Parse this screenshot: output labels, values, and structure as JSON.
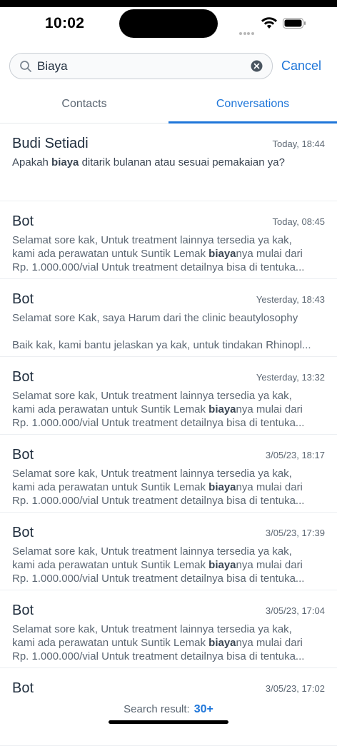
{
  "status_bar": {
    "time": "10:02"
  },
  "search": {
    "value": "Biaya",
    "cancel_label": "Cancel"
  },
  "tabs": [
    {
      "label": "Contacts",
      "active": false
    },
    {
      "label": "Conversations",
      "active": true
    }
  ],
  "conversations": [
    {
      "name": "Budi Setiadi",
      "date": "Today, 18:44",
      "lines": [
        [
          "Apakah ",
          "biaya",
          " ditarik bulanan atau sesuai pemakaian ya?"
        ]
      ]
    },
    {
      "name": "Bot",
      "date": "Today, 08:45",
      "lines": [
        [
          "Selamat sore kak, Untuk treatment lainnya tersedia ya kak,"
        ],
        [
          "kami ada perawatan untuk Suntik Lemak ",
          "biaya",
          "nya mulai dari"
        ],
        [
          "Rp. 1.000.000/vial Untuk treatment detailnya bisa di tentuka..."
        ]
      ]
    },
    {
      "name": "Bot",
      "date": "Yesterday, 18:43",
      "lines": [
        [
          "Selamat sore Kak, saya Harum dari the clinic beautylosophy"
        ],
        [],
        [
          "Baik kak, kami bantu jelaskan ya kak, untuk tindakan Rhinopl..."
        ]
      ]
    },
    {
      "name": "Bot",
      "date": "Yesterday, 13:32",
      "lines": [
        [
          "Selamat sore kak, Untuk treatment lainnya tersedia ya kak,"
        ],
        [
          "kami ada perawatan untuk Suntik Lemak ",
          "biaya",
          "nya mulai dari"
        ],
        [
          "Rp. 1.000.000/vial Untuk treatment detailnya bisa di tentuka..."
        ]
      ]
    },
    {
      "name": "Bot",
      "date": "3/05/23, 18:17",
      "lines": [
        [
          "Selamat sore kak, Untuk treatment lainnya tersedia ya kak,"
        ],
        [
          "kami ada perawatan untuk Suntik Lemak ",
          "biaya",
          "nya mulai dari"
        ],
        [
          "Rp. 1.000.000/vial Untuk treatment detailnya bisa di tentuka..."
        ]
      ]
    },
    {
      "name": "Bot",
      "date": "3/05/23, 17:39",
      "lines": [
        [
          "Selamat sore kak, Untuk treatment lainnya tersedia ya kak,"
        ],
        [
          "kami ada perawatan untuk Suntik Lemak ",
          "biaya",
          "nya mulai dari"
        ],
        [
          "Rp. 1.000.000/vial Untuk treatment detailnya bisa di tentuka..."
        ]
      ]
    },
    {
      "name": "Bot",
      "date": "3/05/23, 17:04",
      "lines": [
        [
          "Selamat sore kak, Untuk treatment lainnya tersedia ya kak,"
        ],
        [
          "kami ada perawatan untuk Suntik Lemak ",
          "biaya",
          "nya mulai dari"
        ],
        [
          "Rp. 1.000.000/vial Untuk treatment detailnya bisa di tentuka..."
        ]
      ]
    },
    {
      "name": "Bot",
      "date": "3/05/23, 17:02",
      "lines": []
    }
  ],
  "footer": {
    "label": "Search result:",
    "count": "30+"
  },
  "colors": {
    "accent": "#1f76d9",
    "text": "#1f2d3d",
    "muted": "#5c6773"
  },
  "icons": {
    "search": "magnifier-icon",
    "clear": "clear-circle-icon",
    "wifi": "wifi-icon",
    "battery": "battery-icon"
  }
}
